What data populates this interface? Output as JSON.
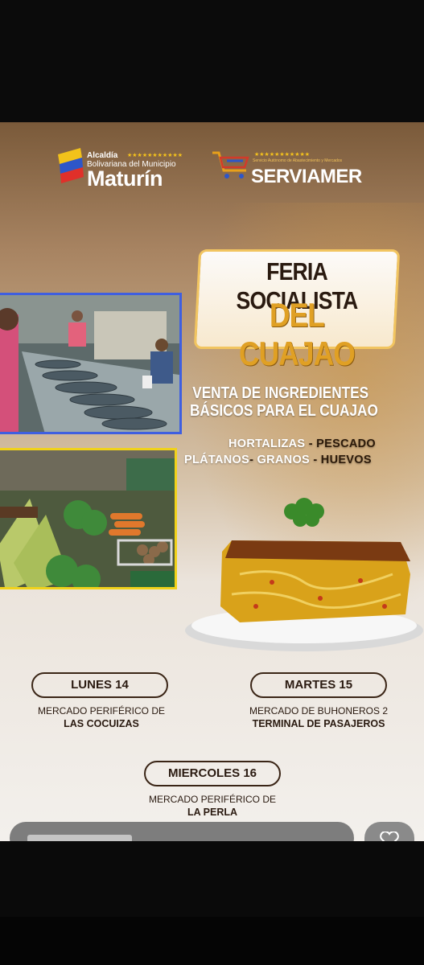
{
  "logos": {
    "alcaldia_line1": "Alcaldía",
    "alcaldia_line2": "Bolivariana del Municipio",
    "alcaldia_name": "Maturín",
    "serviamer_sub": "Servicio Autónomo de Abastecimiento y Mercados",
    "serviamer_name": "SERVIAMER",
    "stars": "★★★★★★★★★★★"
  },
  "title": {
    "line1": "FERIA SOCIALISTA",
    "line2": "DEL CUAJAO"
  },
  "subtitle": {
    "line1": "VENTA DE INGREDIENTES",
    "line2": "BÁSICOS PARA EL CUAJAO"
  },
  "products": {
    "row1_a": "HORTALIZAS",
    "row1_sep": " - ",
    "row1_b": "PESCADO",
    "row2_a": "PLÁTANOS",
    "row2_sep1": "- ",
    "row2_b": "GRANOS",
    "row2_sep2": " - ",
    "row2_c": "HUEVOS"
  },
  "schedule": [
    {
      "day": "LUNES 14",
      "place_line1": "MERCADO PERIFÉRICO DE",
      "place_line2": "LAS COCUIZAS"
    },
    {
      "day": "MARTES 15",
      "place_line1": "MERCADO DE BUHONEROS 2",
      "place_line2": "TERMINAL DE PASAJEROS"
    },
    {
      "day": "MIERCOLES 16",
      "place_line1": "MERCADO PERIFÉRICO DE",
      "place_line2": "LA PERLA"
    }
  ],
  "colors": {
    "gold": "#f2c560",
    "photo1_border": "#3f5fe0",
    "photo2_border": "#f1d21a",
    "dark_text": "#2a1a10"
  }
}
